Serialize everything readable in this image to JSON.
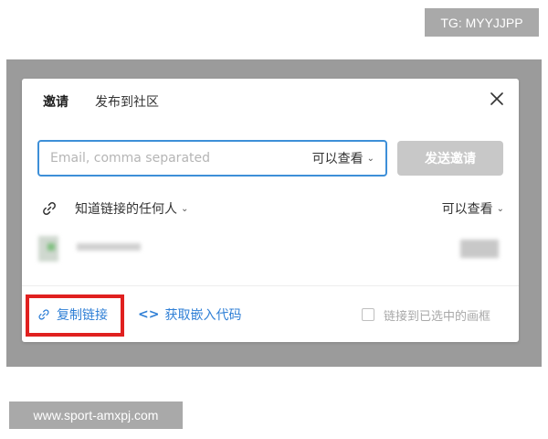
{
  "watermarks": {
    "top": "TG: MYYJJPP",
    "bottom": "www.sport-amxpj.com"
  },
  "dialog": {
    "tabs": [
      {
        "label": "邀请",
        "active": true
      },
      {
        "label": "发布到社区",
        "active": false
      }
    ],
    "invite": {
      "email_placeholder": "Email, comma separated",
      "email_value": "",
      "permission": "可以查看",
      "send_label": "发送邀请"
    },
    "link_access": {
      "who": "知道链接的任何人",
      "permission": "可以查看"
    },
    "footer": {
      "copy_link": "复制链接",
      "embed_code": "获取嵌入代码",
      "link_to_frame": "链接到已选中的画框",
      "link_to_frame_checked": false
    }
  },
  "colors": {
    "accent": "#2f7fd6",
    "input_focus": "#3d8fd8",
    "highlight": "#e0201f",
    "disabled_button": "#c8c8c8"
  }
}
